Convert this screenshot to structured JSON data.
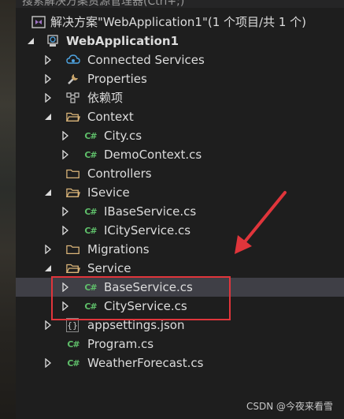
{
  "search": {
    "placeholder": "搜索解决方案资源管理器(Ctrl+;)"
  },
  "solution": {
    "label": "解决方案\"WebApplication1\"(1 个项目/共 1 个)"
  },
  "project": {
    "label": "WebApplication1"
  },
  "items": {
    "connected_services": "Connected Services",
    "properties": "Properties",
    "dependencies": "依赖项",
    "context": "Context",
    "city_cs": "City.cs",
    "democontext_cs": "DemoContext.cs",
    "controllers": "Controllers",
    "isevice": "ISevice",
    "ibaseservice_cs": "IBaseService.cs",
    "icityservice_cs": "ICityService.cs",
    "migrations": "Migrations",
    "service": "Service",
    "baseservice_cs": "BaseService.cs",
    "cityservice_cs": "CityService.cs",
    "appsettings_json": "appsettings.json",
    "program_cs": "Program.cs",
    "weatherforecast_cs": "WeatherForecast.cs"
  },
  "icons": {
    "csharp": "C#",
    "json": "{}"
  },
  "watermark": "CSDN @今夜来看雪",
  "colors": {
    "background": "#1e1e1e",
    "selected_row": "#3f3f46",
    "folder": "#dcb67a",
    "csharp_icon": "#5fbf6a",
    "annotation_red": "#e0353b"
  }
}
